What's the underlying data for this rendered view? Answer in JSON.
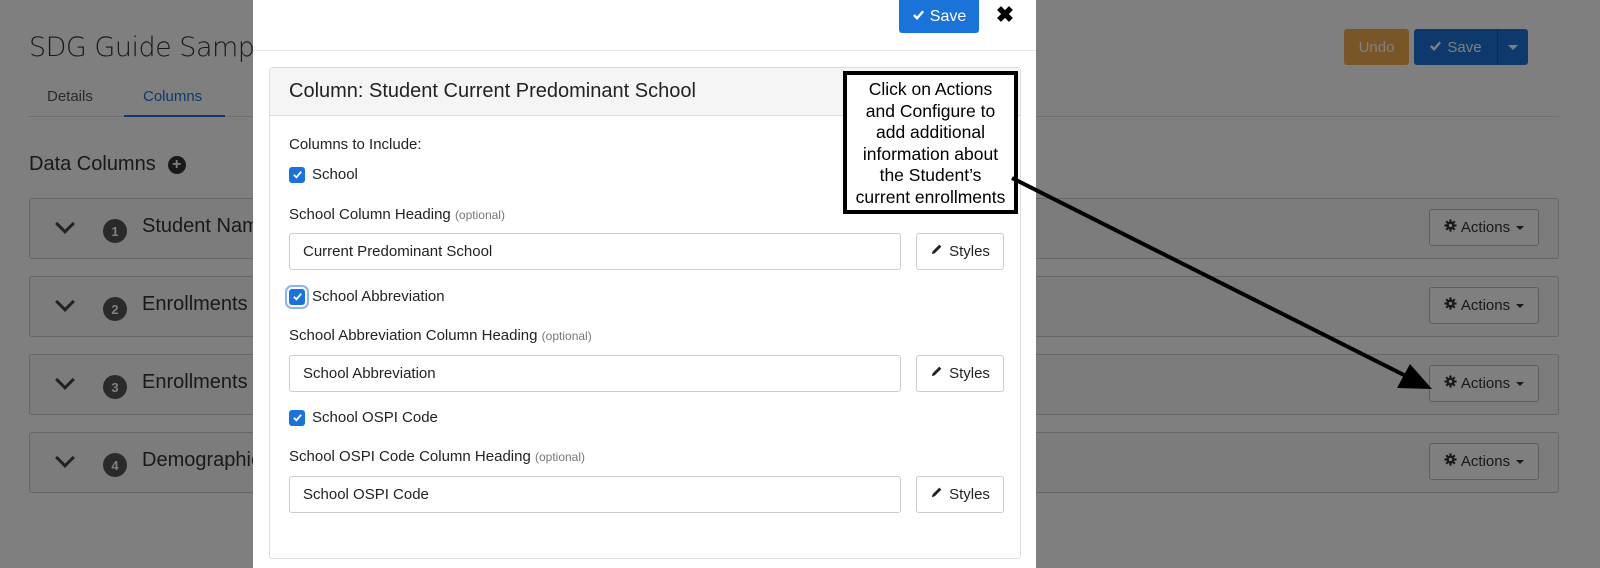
{
  "page": {
    "title": "SDG Guide Sample",
    "undo_label": "Undo",
    "save_label": "Save",
    "tabs": [
      {
        "label": "Details"
      },
      {
        "label": "Columns"
      }
    ],
    "section_title": "Data Columns",
    "rows": [
      {
        "number": "1",
        "label": "Student Name",
        "actions_label": "Actions"
      },
      {
        "number": "2",
        "label": "Enrollments",
        "actions_label": "Actions"
      },
      {
        "number": "3",
        "label": "Enrollments",
        "actions_label": "Actions"
      },
      {
        "number": "4",
        "label": "Demographics",
        "actions_label": "Actions"
      }
    ]
  },
  "modal": {
    "save_label": "Save",
    "panel_title": "Column: Student Current Predominant School",
    "columns_to_include_label": "Columns to Include:",
    "optional_label": "(optional)",
    "styles_label": "Styles",
    "fields": [
      {
        "checkbox_label": "School",
        "heading_label": "School Column Heading",
        "value": "Current Predominant School"
      },
      {
        "checkbox_label": "School Abbreviation",
        "heading_label": "School Abbreviation Column Heading",
        "value": "School Abbreviation"
      },
      {
        "checkbox_label": "School OSPI Code",
        "heading_label": "School OSPI Code Column Heading",
        "value": "School OSPI Code"
      }
    ]
  },
  "callout": {
    "lines": [
      "Click on Actions",
      "and Configure to",
      "add additional",
      "information about",
      "the Student’s",
      "current enrollments"
    ]
  },
  "colors": {
    "primary": "#1a73d8",
    "warning": "#f0ad4e",
    "overlay": "rgba(0,0,0,0.5)"
  }
}
